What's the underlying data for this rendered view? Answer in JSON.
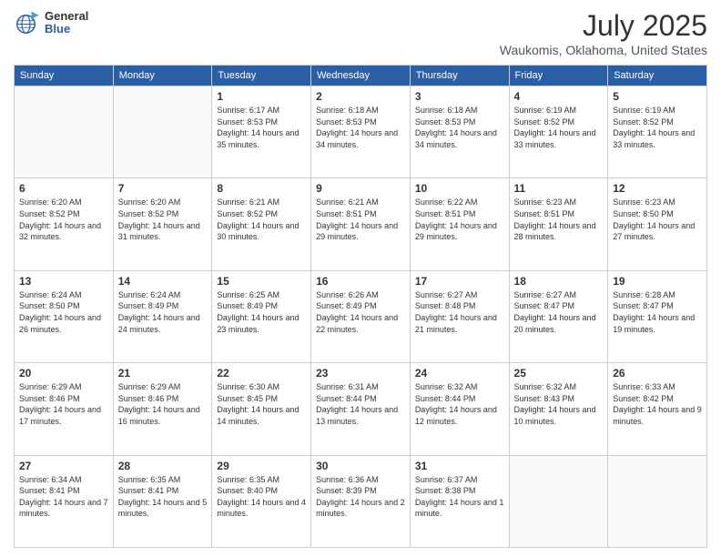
{
  "header": {
    "logo": {
      "general": "General",
      "blue": "Blue"
    },
    "title": "July 2025",
    "location": "Waukomis, Oklahoma, United States"
  },
  "weekdays": [
    "Sunday",
    "Monday",
    "Tuesday",
    "Wednesday",
    "Thursday",
    "Friday",
    "Saturday"
  ],
  "weeks": [
    [
      {
        "day": null
      },
      {
        "day": null
      },
      {
        "day": 1,
        "sunrise": "6:17 AM",
        "sunset": "8:53 PM",
        "daylight": "14 hours and 35 minutes."
      },
      {
        "day": 2,
        "sunrise": "6:18 AM",
        "sunset": "8:53 PM",
        "daylight": "14 hours and 34 minutes."
      },
      {
        "day": 3,
        "sunrise": "6:18 AM",
        "sunset": "8:53 PM",
        "daylight": "14 hours and 34 minutes."
      },
      {
        "day": 4,
        "sunrise": "6:19 AM",
        "sunset": "8:52 PM",
        "daylight": "14 hours and 33 minutes."
      },
      {
        "day": 5,
        "sunrise": "6:19 AM",
        "sunset": "8:52 PM",
        "daylight": "14 hours and 33 minutes."
      }
    ],
    [
      {
        "day": 6,
        "sunrise": "6:20 AM",
        "sunset": "8:52 PM",
        "daylight": "14 hours and 32 minutes."
      },
      {
        "day": 7,
        "sunrise": "6:20 AM",
        "sunset": "8:52 PM",
        "daylight": "14 hours and 31 minutes."
      },
      {
        "day": 8,
        "sunrise": "6:21 AM",
        "sunset": "8:52 PM",
        "daylight": "14 hours and 30 minutes."
      },
      {
        "day": 9,
        "sunrise": "6:21 AM",
        "sunset": "8:51 PM",
        "daylight": "14 hours and 29 minutes."
      },
      {
        "day": 10,
        "sunrise": "6:22 AM",
        "sunset": "8:51 PM",
        "daylight": "14 hours and 29 minutes."
      },
      {
        "day": 11,
        "sunrise": "6:23 AM",
        "sunset": "8:51 PM",
        "daylight": "14 hours and 28 minutes."
      },
      {
        "day": 12,
        "sunrise": "6:23 AM",
        "sunset": "8:50 PM",
        "daylight": "14 hours and 27 minutes."
      }
    ],
    [
      {
        "day": 13,
        "sunrise": "6:24 AM",
        "sunset": "8:50 PM",
        "daylight": "14 hours and 26 minutes."
      },
      {
        "day": 14,
        "sunrise": "6:24 AM",
        "sunset": "8:49 PM",
        "daylight": "14 hours and 24 minutes."
      },
      {
        "day": 15,
        "sunrise": "6:25 AM",
        "sunset": "8:49 PM",
        "daylight": "14 hours and 23 minutes."
      },
      {
        "day": 16,
        "sunrise": "6:26 AM",
        "sunset": "8:49 PM",
        "daylight": "14 hours and 22 minutes."
      },
      {
        "day": 17,
        "sunrise": "6:27 AM",
        "sunset": "8:48 PM",
        "daylight": "14 hours and 21 minutes."
      },
      {
        "day": 18,
        "sunrise": "6:27 AM",
        "sunset": "8:47 PM",
        "daylight": "14 hours and 20 minutes."
      },
      {
        "day": 19,
        "sunrise": "6:28 AM",
        "sunset": "8:47 PM",
        "daylight": "14 hours and 19 minutes."
      }
    ],
    [
      {
        "day": 20,
        "sunrise": "6:29 AM",
        "sunset": "8:46 PM",
        "daylight": "14 hours and 17 minutes."
      },
      {
        "day": 21,
        "sunrise": "6:29 AM",
        "sunset": "8:46 PM",
        "daylight": "14 hours and 16 minutes."
      },
      {
        "day": 22,
        "sunrise": "6:30 AM",
        "sunset": "8:45 PM",
        "daylight": "14 hours and 14 minutes."
      },
      {
        "day": 23,
        "sunrise": "6:31 AM",
        "sunset": "8:44 PM",
        "daylight": "14 hours and 13 minutes."
      },
      {
        "day": 24,
        "sunrise": "6:32 AM",
        "sunset": "8:44 PM",
        "daylight": "14 hours and 12 minutes."
      },
      {
        "day": 25,
        "sunrise": "6:32 AM",
        "sunset": "8:43 PM",
        "daylight": "14 hours and 10 minutes."
      },
      {
        "day": 26,
        "sunrise": "6:33 AM",
        "sunset": "8:42 PM",
        "daylight": "14 hours and 9 minutes."
      }
    ],
    [
      {
        "day": 27,
        "sunrise": "6:34 AM",
        "sunset": "8:41 PM",
        "daylight": "14 hours and 7 minutes."
      },
      {
        "day": 28,
        "sunrise": "6:35 AM",
        "sunset": "8:41 PM",
        "daylight": "14 hours and 5 minutes."
      },
      {
        "day": 29,
        "sunrise": "6:35 AM",
        "sunset": "8:40 PM",
        "daylight": "14 hours and 4 minutes."
      },
      {
        "day": 30,
        "sunrise": "6:36 AM",
        "sunset": "8:39 PM",
        "daylight": "14 hours and 2 minutes."
      },
      {
        "day": 31,
        "sunrise": "6:37 AM",
        "sunset": "8:38 PM",
        "daylight": "14 hours and 1 minute."
      },
      {
        "day": null
      },
      {
        "day": null
      }
    ]
  ],
  "labels": {
    "sunrise": "Sunrise:",
    "sunset": "Sunset:",
    "daylight": "Daylight:"
  }
}
